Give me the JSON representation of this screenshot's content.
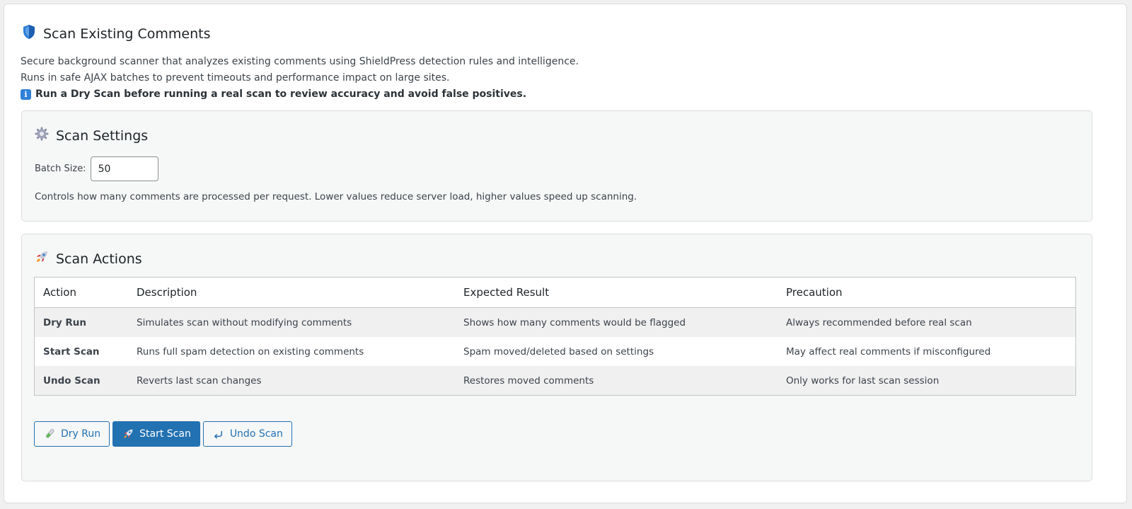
{
  "header": {
    "title": "Scan Existing Comments",
    "title_icon": "shield-icon"
  },
  "intro": {
    "line1": "Secure background scanner that analyzes existing comments using ShieldPress detection rules and intelligence.",
    "line2": "Runs in safe AJAX batches to prevent timeouts and performance impact on large sites.",
    "note": "Run a Dry Scan before running a real scan to review accuracy and avoid false positives.",
    "note_icon": "info-icon"
  },
  "settings": {
    "title": "Scan Settings",
    "title_icon": "gear-icon",
    "batch_label": "Batch Size:",
    "batch_value": "50",
    "help": "Controls how many comments are processed per request. Lower values reduce server load, higher values speed up scanning."
  },
  "actions": {
    "title": "Scan Actions",
    "title_icon": "rocket-icon",
    "columns": [
      "Action",
      "Description",
      "Expected Result",
      "Precaution"
    ],
    "rows": [
      {
        "action": "Dry Run",
        "description": "Simulates scan without modifying comments",
        "result": "Shows how many comments would be flagged",
        "precaution": "Always recommended before real scan",
        "warning": false
      },
      {
        "action": "Start Scan",
        "description": "Runs full spam detection on existing comments",
        "result": "Spam moved/deleted based on settings",
        "precaution": "May affect real comments if misconfigured",
        "warning": true
      },
      {
        "action": "Undo Scan",
        "description": "Reverts last scan changes",
        "result": "Restores moved comments",
        "precaution": "Only works for last scan session",
        "warning": false
      }
    ],
    "buttons": {
      "dry_run": "Dry Run",
      "start_scan": "Start Scan",
      "undo_scan": "Undo Scan"
    }
  },
  "colors": {
    "accent": "#2271b1",
    "danger": "#d63638",
    "card_bg": "#f6f7f7",
    "border": "#dcdcde"
  }
}
